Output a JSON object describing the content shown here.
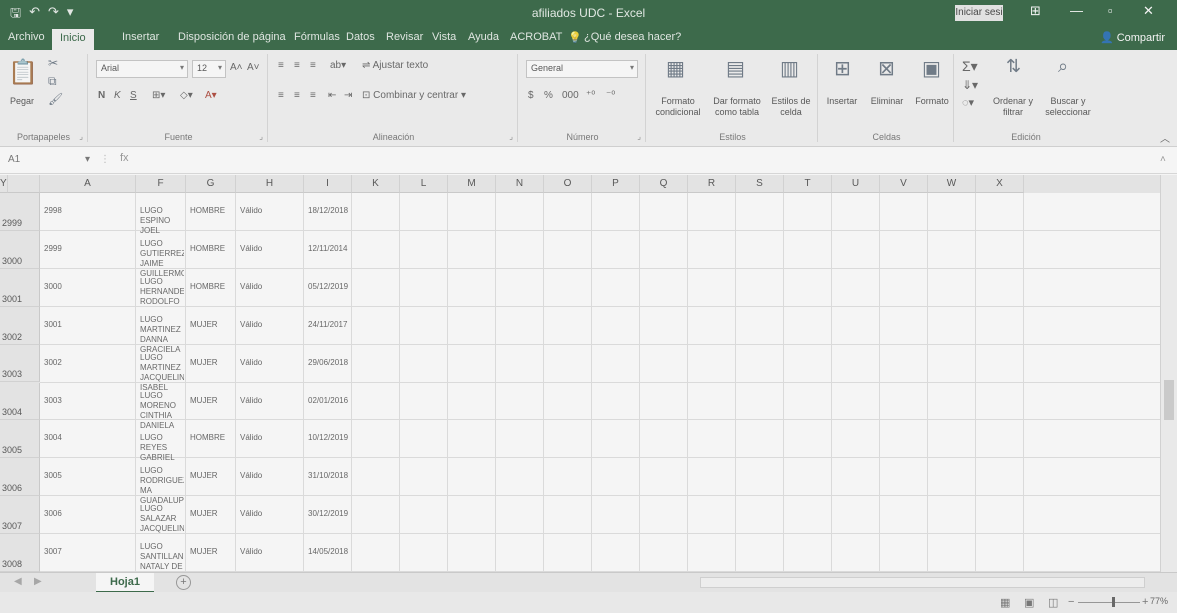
{
  "window": {
    "title": "afiliados UDC - Excel",
    "signin": "Iniciar sesi",
    "qat_icons": [
      "save-icon",
      "undo-icon",
      "redo-icon",
      "customize-icon"
    ]
  },
  "tabs": [
    "Archivo",
    "Inicio",
    "Insertar",
    "Disposición de página",
    "Fórmulas",
    "Datos",
    "Revisar",
    "Vista",
    "Ayuda",
    "ACROBAT"
  ],
  "tellme": "¿Qué desea hacer?",
  "share": "Compartir",
  "ribbon": {
    "portapapeles": {
      "label": "Portapapeles",
      "paste": "Pegar"
    },
    "fuente": {
      "label": "Fuente",
      "font": "Arial",
      "size": "12",
      "bold": "N",
      "italic": "K",
      "underline": "S"
    },
    "alineacion": {
      "label": "Alineación",
      "wrap": "Ajustar texto",
      "merge": "Combinar y centrar"
    },
    "numero": {
      "label": "Número",
      "format": "General",
      "currency": "$",
      "percent": "%",
      "thousands": "000"
    },
    "estilos": {
      "label": "Estilos",
      "cond": "Formato condicional",
      "table": "Dar formato como tabla",
      "cellstyles": "Estilos de celda"
    },
    "celdas": {
      "label": "Celdas",
      "insert": "Insertar",
      "delete": "Eliminar",
      "format": "Formato"
    },
    "edicion": {
      "label": "Edición",
      "sort": "Ordenar y filtrar",
      "find": "Buscar y seleccionar"
    }
  },
  "formula_bar": {
    "namebox": "A1",
    "fx": "fx",
    "content": ""
  },
  "columns": [
    "A",
    "F",
    "G",
    "H",
    "I",
    "K",
    "L",
    "M",
    "N",
    "O",
    "P",
    "Q",
    "R",
    "S",
    "T",
    "U",
    "V",
    "W",
    "X",
    "Y"
  ],
  "rows": [
    {
      "num": "2999",
      "id": "2998",
      "name": "LUGO ESPINO JOEL",
      "gender": "HOMBRE",
      "status": "Válido",
      "date": "18/12/2018"
    },
    {
      "num": "3000",
      "id": "2999",
      "name": "LUGO GUTIERREZ JAIME\nGUILLERMO",
      "gender": "HOMBRE",
      "status": "Válido",
      "date": "12/11/2014"
    },
    {
      "num": "3001",
      "id": "3000",
      "name": "LUGO HERNANDEZ\nRODOLFO",
      "gender": "HOMBRE",
      "status": "Válido",
      "date": "05/12/2019"
    },
    {
      "num": "3002",
      "id": "3001",
      "name": "LUGO MARTINEZ DANNA\nGRACIELA",
      "gender": "MUJER",
      "status": "Válido",
      "date": "24/11/2017"
    },
    {
      "num": "3003",
      "id": "3002",
      "name": "LUGO MARTINEZ\nJACQUELINE ISABEL",
      "gender": "MUJER",
      "status": "Válido",
      "date": "29/06/2018"
    },
    {
      "num": "3004",
      "id": "3003",
      "name": "LUGO MORENO CINTHIA\nDANIELA",
      "gender": "MUJER",
      "status": "Válido",
      "date": "02/01/2016"
    },
    {
      "num": "3005",
      "id": "3004",
      "name": "LUGO REYES GABRIEL",
      "gender": "HOMBRE",
      "status": "Válido",
      "date": "10/12/2019"
    },
    {
      "num": "3006",
      "id": "3005",
      "name": "LUGO RODRIGUEZ MA\nGUADALUPE",
      "gender": "MUJER",
      "status": "Válido",
      "date": "31/10/2018"
    },
    {
      "num": "3007",
      "id": "3006",
      "name": "LUGO SALAZAR\nJACQUELINE",
      "gender": "MUJER",
      "status": "Válido",
      "date": "30/12/2019"
    },
    {
      "num": "3008",
      "id": "3007",
      "name": "LUGO SANTILLAN\nNATALY DE JESUS",
      "gender": "MUJER",
      "status": "Válido",
      "date": "14/05/2018"
    }
  ],
  "sheet_tab": "Hoja1",
  "zoom": "77%"
}
